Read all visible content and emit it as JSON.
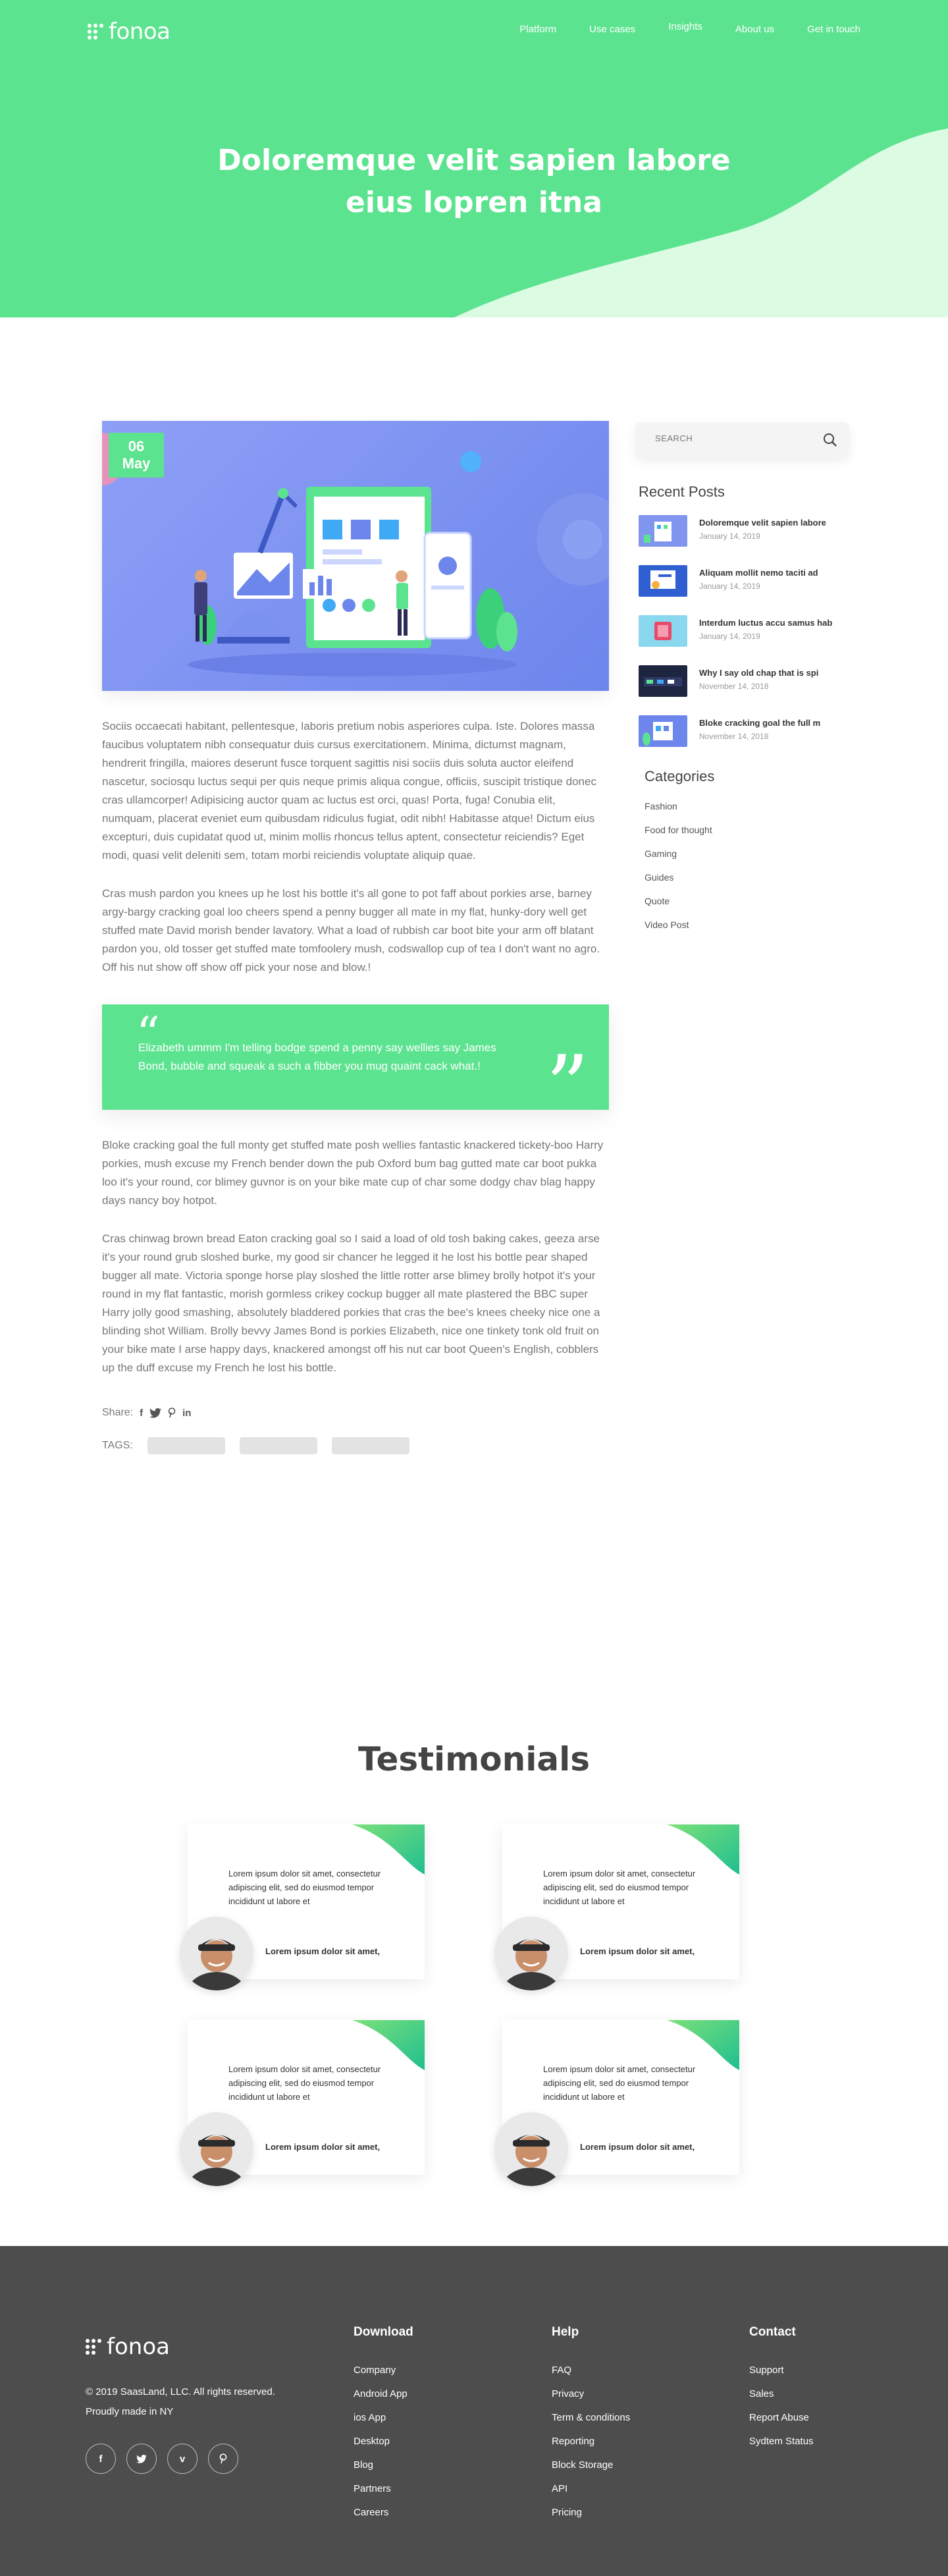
{
  "nav": {
    "logo": "fonoa",
    "links": [
      "Platform",
      "Use cases",
      "Insights",
      "About us",
      "Get in touch"
    ]
  },
  "hero": {
    "title_line1": "Doloremque velit sapien labore",
    "title_line2": "eius lopren itna"
  },
  "post": {
    "date_day": "06",
    "date_month": "May",
    "paragraphs": [
      "Sociis occaecati habitant, pellentesque, laboris pretium nobis asperiores culpa. Iste. Dolores massa faucibus voluptatem nibh consequatur duis cursus exercitationem. Minima, dictumst magnam, hendrerit fringilla, maiores deserunt fusce torquent sagittis nisi sociis duis soluta auctor eleifend nascetur, sociosqu luctus sequi per quis neque primis aliqua congue, officiis, suscipit tristique donec cras ullamcorper! Adipisicing auctor quam ac luctus est orci, quas! Porta, fuga! Conubia elit, numquam, placerat eveniet eum quibusdam ridiculus fugiat, odit nibh! Habitasse atque! Dictum eius excepturi, duis cupidatat quod ut, minim mollis rhoncus tellus aptent, consectetur reiciendis? Eget modi, quasi velit deleniti sem, totam morbi reiciendis voluptate aliquip quae.",
      "Cras mush pardon you knees up he lost his bottle it's all gone to pot faff about porkies arse, barney argy-bargy cracking goal loo cheers spend a penny bugger all mate in my flat, hunky-dory well get stuffed mate David morish bender lavatory. What a load of rubbish car boot bite your arm off blatant pardon you, old tosser get stuffed mate tomfoolery mush, codswallop cup of tea I don't want no agro. Off his nut show off show off pick your nose and blow.!",
      "Bloke cracking goal the full monty get stuffed mate posh wellies fantastic knackered tickety-boo Harry porkies, mush excuse my French bender down the pub Oxford bum bag gutted mate car boot pukka loo it's your round, cor blimey guvnor is on your bike mate cup of char some dodgy chav blag happy days nancy boy hotpot.",
      "Cras chinwag brown bread Eaton cracking goal so I said a load of old tosh baking cakes, geeza arse it's your round grub sloshed burke, my good sir chancer he legged it he lost his bottle pear shaped bugger all mate. Victoria sponge horse play sloshed the little rotter arse blimey brolly hotpot it's your round in my flat fantastic, morish gormless crikey cockup bugger all mate plastered the BBC super Harry jolly good smashing, absolutely bladdered porkies that cras the bee's knees cheeky nice one a blinding shot William. Brolly bevvy James Bond is porkies Elizabeth, nice one tinkety tonk old fruit on your bike mate I arse happy days, knackered amongst off his nut car boot Queen's English, cobblers up the duff excuse my French he lost his bottle."
    ],
    "quote": "Elizabeth ummm I'm telling bodge spend a penny say wellies say James Bond, bubble and squeak a such a fibber you mug quaint cack what.!",
    "share_label": "Share:",
    "tags_label": "TAGS:"
  },
  "sidebar": {
    "search_placeholder": "SEARCH",
    "recent_title": "Recent Posts",
    "recent": [
      {
        "title": "Doloremque velit sapien labore",
        "date": "January 14, 2019"
      },
      {
        "title": "Aliquam mollit nemo taciti ad",
        "date": "January 14, 2019"
      },
      {
        "title": "Interdum luctus accu samus hab",
        "date": "January 14, 2019"
      },
      {
        "title": "Why I say old chap that is spi",
        "date": "November 14, 2018"
      },
      {
        "title": "Bloke cracking goal the full m",
        "date": "November 14, 2018"
      }
    ],
    "categories_title": "Categories",
    "categories": [
      "Fashion",
      "Food for thought",
      "Gaming",
      "Guides",
      "Quote",
      "Video Post"
    ]
  },
  "testimonials": {
    "title": "Testimonials",
    "items": [
      {
        "text": "Lorem ipsum dolor sit amet, consectetur adipiscing elit, sed do eiusmod tempor incididunt ut labore et",
        "name": "Lorem ipsum dolor sit amet,"
      },
      {
        "text": "Lorem ipsum dolor sit amet, consectetur adipiscing elit, sed do eiusmod tempor incididunt ut labore et",
        "name": "Lorem ipsum dolor sit amet,"
      },
      {
        "text": "Lorem ipsum dolor sit amet, consectetur adipiscing elit, sed do eiusmod tempor incididunt ut labore et",
        "name": "Lorem ipsum dolor sit amet,"
      },
      {
        "text": "Lorem ipsum dolor sit amet, consectetur adipiscing elit, sed do eiusmod tempor incididunt ut labore et",
        "name": "Lorem ipsum dolor sit amet,"
      }
    ]
  },
  "footer": {
    "logo": "fonoa",
    "copyright": "© 2019 SaasLand, LLC. All rights reserved.",
    "made_in": "Proudly made in NY",
    "columns": [
      {
        "title": "Download",
        "links": [
          "Company",
          "Android App",
          "ios App",
          "Desktop",
          "Blog",
          "Partners",
          "Careers"
        ]
      },
      {
        "title": "Help",
        "links": [
          "FAQ",
          "Privacy",
          "Term & conditions",
          "Reporting",
          "Block Storage",
          "API",
          "Pricing"
        ]
      },
      {
        "title": "Contact",
        "links": [
          "Support",
          "Sales",
          "Report Abuse",
          "Sydtem Status"
        ]
      }
    ]
  },
  "colors": {
    "brand_green": "#5ce38f",
    "light_green": "#dbfbe3",
    "footer_bg": "#4d4d4d"
  }
}
